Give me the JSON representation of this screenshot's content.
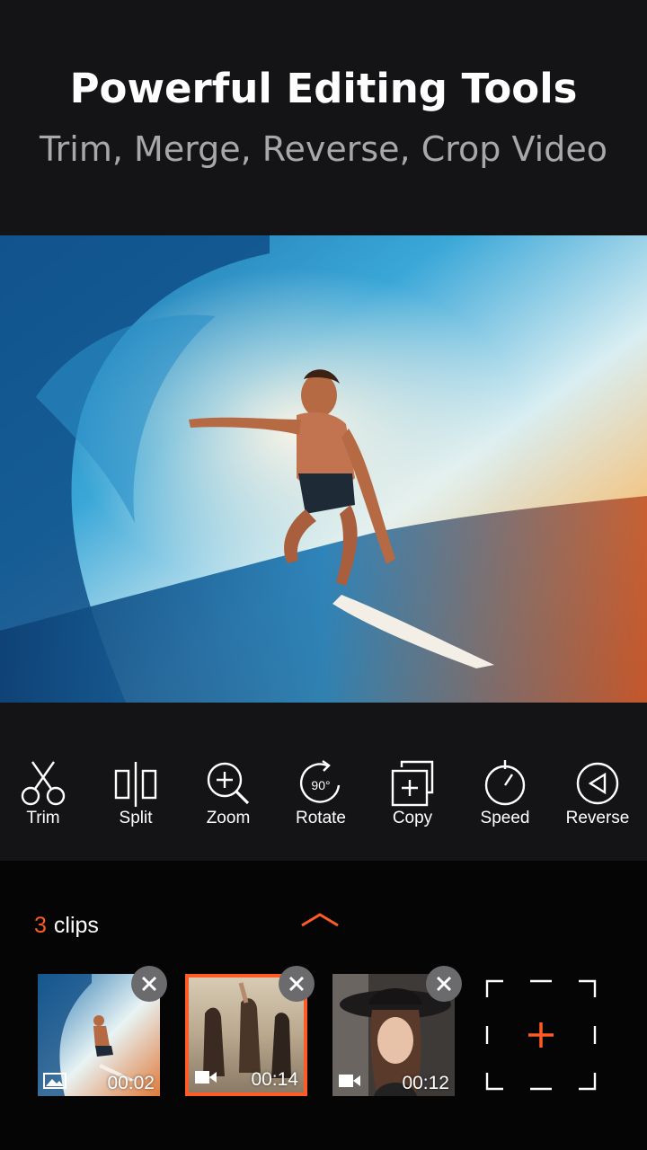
{
  "header": {
    "title": "Powerful Editing Tools",
    "subtitle": "Trim, Merge, Reverse, Crop Video"
  },
  "hero": {
    "image": "surfer-in-wave-photo"
  },
  "tools": [
    {
      "label": "Trim",
      "icon": "scissors-icon"
    },
    {
      "label": "Split",
      "icon": "split-icon"
    },
    {
      "label": "Zoom",
      "icon": "zoom-in-icon"
    },
    {
      "label": "Rotate",
      "icon": "rotate-90-icon",
      "badge": "90°"
    },
    {
      "label": "Copy",
      "icon": "copy-add-icon"
    },
    {
      "label": "Speed",
      "icon": "speed-icon"
    },
    {
      "label": "Reverse",
      "icon": "reverse-icon"
    }
  ],
  "clips": {
    "count": "3",
    "label": "clips",
    "items": [
      {
        "duration": "00:02",
        "type": "image",
        "selected": false
      },
      {
        "duration": "00:14",
        "type": "video",
        "selected": true
      },
      {
        "duration": "00:12",
        "type": "video",
        "selected": false
      }
    ]
  },
  "colors": {
    "accent": "#ff5b24",
    "background": "#141416",
    "clips_bar": "#050505"
  }
}
